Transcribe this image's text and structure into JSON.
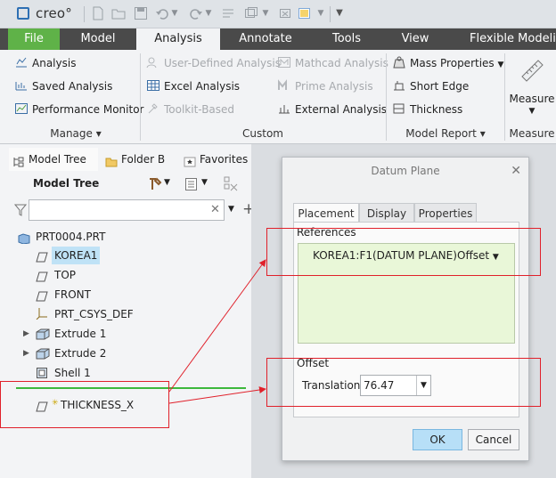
{
  "app": {
    "logo_text": "creo°"
  },
  "quick_access": {
    "icons": [
      "new-icon",
      "open-icon",
      "save-icon",
      "undo-icon",
      "redo-icon",
      "regenerate-icon",
      "windows-icon",
      "close-window-icon",
      "display-icon",
      "customize-icon"
    ]
  },
  "tabs": [
    "File",
    "Model",
    "Analysis",
    "Annotate",
    "Tools",
    "View",
    "Flexible Modelin"
  ],
  "ribbon": {
    "manage": {
      "items": [
        "Analysis",
        "Saved Analysis",
        "Performance Monitor"
      ],
      "label": "Manage"
    },
    "custom": {
      "items": [
        "User-Defined Analysis",
        "Excel Analysis",
        "Toolkit-Based",
        "Mathcad Analysis",
        "Prime Analysis",
        "External Analysis"
      ],
      "label": "Custom"
    },
    "model_report": {
      "items": [
        "Mass Properties",
        "Short Edge",
        "Thickness"
      ],
      "label": "Model Report"
    },
    "measure": {
      "button": "Measure",
      "label": "Measure"
    }
  },
  "left_panel": {
    "tabs": [
      "Model Tree",
      "Folder B",
      "Favorites"
    ],
    "header": "Model Tree",
    "filter_placeholder": "",
    "tree": [
      {
        "label": "PRT0004.PRT",
        "icon": "part-icon"
      },
      {
        "label": "KOREA1",
        "icon": "datum-plane-icon",
        "selected": true
      },
      {
        "label": "TOP",
        "icon": "datum-plane-icon"
      },
      {
        "label": "FRONT",
        "icon": "datum-plane-icon"
      },
      {
        "label": "PRT_CSYS_DEF",
        "icon": "csys-icon"
      },
      {
        "label": "Extrude 1",
        "icon": "extrude-icon",
        "expandable": true
      },
      {
        "label": "Extrude 2",
        "icon": "extrude-icon",
        "expandable": true
      },
      {
        "label": "Shell 1",
        "icon": "shell-icon"
      },
      {
        "label": "THICKNESS_X",
        "icon": "datum-plane-icon",
        "new": true
      }
    ]
  },
  "dialog": {
    "title": "Datum Plane",
    "tabs": [
      "Placement",
      "Display",
      "Properties"
    ],
    "references_label": "References",
    "reference": {
      "name": "KOREA1:F1(DATUM PLANE)",
      "type": "Offset"
    },
    "offset_label": "Offset",
    "translation_label": "Translation",
    "translation_value": "76.47",
    "ok": "OK",
    "cancel": "Cancel"
  },
  "colors": {
    "file_tab": "#5fb248",
    "annotation": "#e0202a",
    "insert_line": "#3cb83c",
    "ok_button": "#b7dff7",
    "reference_bg": "#e9f7d8"
  }
}
